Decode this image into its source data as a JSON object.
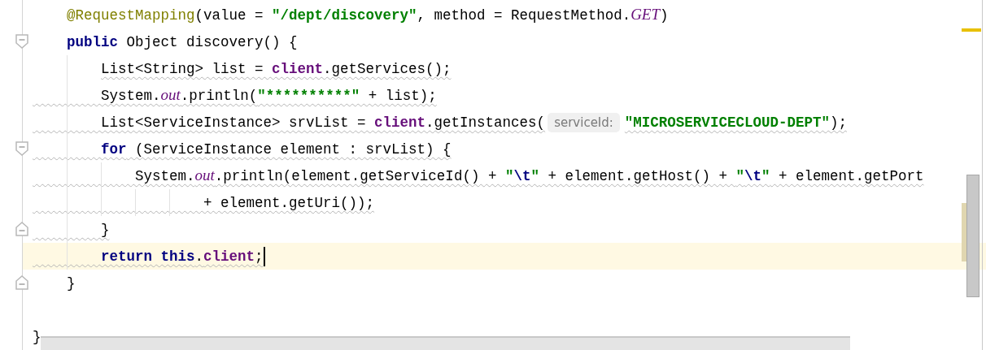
{
  "editor": {
    "lines": [
      {
        "tokens": [
          {
            "text": "    @RequestMapping",
            "kind": "annotation"
          },
          {
            "text": "(value = ",
            "kind": "plain"
          },
          {
            "text": "\"/dept/discovery\"",
            "kind": "string"
          },
          {
            "text": ", method = RequestMethod.",
            "kind": "plain"
          },
          {
            "text": "GET",
            "kind": "static"
          },
          {
            "text": ")",
            "kind": "plain"
          }
        ]
      },
      {
        "fold_start": true,
        "tokens": [
          {
            "text": "    public",
            "kind": "keyword"
          },
          {
            "text": " Object discovery() {",
            "kind": "plain"
          }
        ]
      },
      {
        "warning": true,
        "warning_under_indent": false,
        "tokens": [
          {
            "text": "        List<String> list = ",
            "kind": "plain"
          },
          {
            "text": "client",
            "kind": "field"
          },
          {
            "text": ".getServices();",
            "kind": "plain"
          }
        ]
      },
      {
        "warning": true,
        "warning_under_indent": true,
        "tokens": [
          {
            "text": "        System.",
            "kind": "plain"
          },
          {
            "text": "out",
            "kind": "static"
          },
          {
            "text": ".println(",
            "kind": "plain"
          },
          {
            "text": "\"**********\"",
            "kind": "string"
          },
          {
            "text": " + list);",
            "kind": "plain"
          }
        ]
      },
      {
        "warning": true,
        "warning_under_indent": true,
        "tokens": [
          {
            "text": "        List<ServiceInstance> srvList = ",
            "kind": "plain"
          },
          {
            "text": "client",
            "kind": "field"
          },
          {
            "text": ".getInstances(",
            "kind": "plain"
          },
          {
            "text": "serviceId:",
            "kind": "hint"
          },
          {
            "text": "\"MICROSERVICECLOUD-DEPT\"",
            "kind": "string"
          },
          {
            "text": ");",
            "kind": "plain"
          }
        ]
      },
      {
        "fold_start": true,
        "warning": true,
        "warning_under_indent": true,
        "tokens": [
          {
            "text": "        for",
            "kind": "keyword"
          },
          {
            "text": " (ServiceInstance element : srvList) {",
            "kind": "plain"
          }
        ]
      },
      {
        "warning": true,
        "warning_under_indent": true,
        "tokens": [
          {
            "text": "            System.",
            "kind": "plain"
          },
          {
            "text": "out",
            "kind": "static"
          },
          {
            "text": ".println(element.getServiceId() + ",
            "kind": "plain"
          },
          {
            "text": "\"",
            "kind": "string"
          },
          {
            "text": "\\t",
            "kind": "escape"
          },
          {
            "text": "\"",
            "kind": "string"
          },
          {
            "text": " + element.getHost() + ",
            "kind": "plain"
          },
          {
            "text": "\"",
            "kind": "string"
          },
          {
            "text": "\\t",
            "kind": "escape"
          },
          {
            "text": "\"",
            "kind": "string"
          },
          {
            "text": " + element.getPort",
            "kind": "plain"
          }
        ]
      },
      {
        "warning": true,
        "warning_under_indent": true,
        "tokens": [
          {
            "text": "                    + element.getUri());",
            "kind": "plain"
          }
        ]
      },
      {
        "fold_end": true,
        "warning": true,
        "warning_under_indent": true,
        "tokens": [
          {
            "text": "        }",
            "kind": "plain"
          }
        ]
      },
      {
        "current": true,
        "warning": true,
        "warning_under_indent": true,
        "tokens": [
          {
            "text": "        return this",
            "kind": "keyword"
          },
          {
            "text": ".",
            "kind": "plain"
          },
          {
            "text": "client",
            "kind": "field"
          },
          {
            "text": ";",
            "kind": "plain"
          }
        ]
      },
      {
        "fold_end": true,
        "tokens": [
          {
            "text": "    }",
            "kind": "plain"
          }
        ]
      },
      {
        "current": false
      },
      {
        "tokens": [
          {
            "text": "}",
            "kind": "plain"
          }
        ]
      }
    ]
  }
}
